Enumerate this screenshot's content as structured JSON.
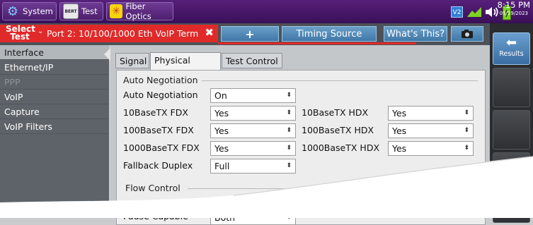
{
  "topbar": {
    "system_label": "System",
    "test_label": "Test",
    "test_icon_text": "BERT",
    "fiber_label": "Fiber Optics",
    "v2_label": "V2",
    "time": "8:15 PM",
    "date": "09/19/2023"
  },
  "tabbar": {
    "select_test": "Select Test",
    "title": "Port 2: 10/100/1000 Eth VoIP Term",
    "close_glyph": "✖",
    "add_glyph": "+",
    "timing_source": "Timing Source",
    "whats_this": "What's This?"
  },
  "leftnav": {
    "items": [
      "Interface",
      "Ethernet/IP",
      "PPP",
      "VoIP",
      "Capture",
      "VoIP Filters"
    ]
  },
  "subtabs": [
    "Signal",
    "Physical Layer",
    "Test Control"
  ],
  "panel": {
    "group_auto_neg": "Auto Negotiation",
    "group_flow": "Flow Control",
    "rows": [
      {
        "label": "Auto Negotiation",
        "value": "On"
      },
      {
        "label": "10BaseTX FDX",
        "value": "Yes",
        "label2": "10BaseTX HDX",
        "value2": "Yes"
      },
      {
        "label": "100BaseTX FDX",
        "value": "Yes",
        "label2": "100BaseTX HDX",
        "value2": "Yes"
      },
      {
        "label": "1000BaseTX FDX",
        "value": "Yes",
        "label2": "1000BaseTX HDX",
        "value2": "Yes"
      },
      {
        "label": "Fallback Duplex",
        "value": "Full"
      }
    ],
    "pause_label": "Pause Capable",
    "pause_value": "Both"
  },
  "rightcol": {
    "results_label": "Results",
    "back_glyph": "🡐"
  },
  "colors": {
    "accent_red": "#e02a2a",
    "accent_blue": "#4a84b8",
    "topbar_purple": "#4a1a6b"
  }
}
